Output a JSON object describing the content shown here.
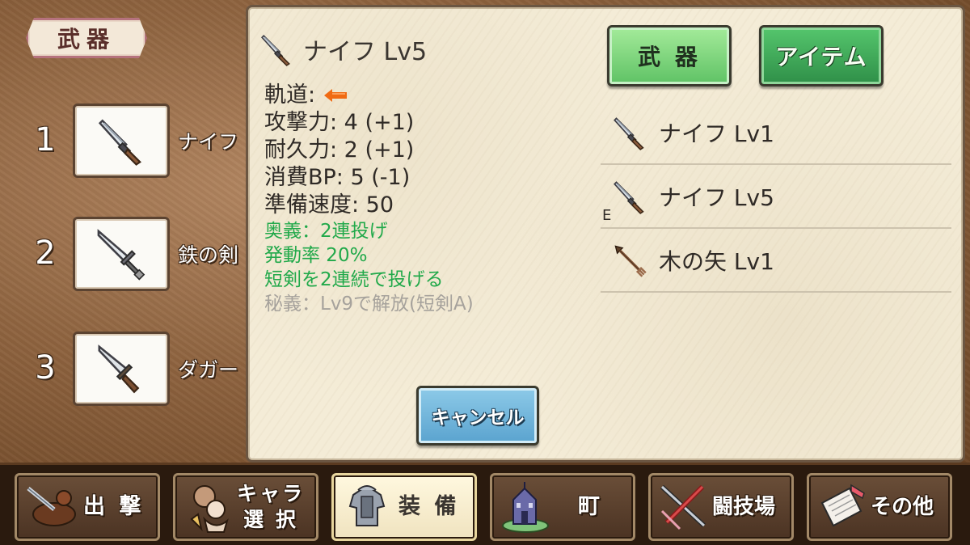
{
  "section_tag": "武器",
  "slots": [
    {
      "number": "1",
      "name": "ナイフ",
      "icon": "knife-icon"
    },
    {
      "number": "2",
      "name": "鉄の剣",
      "icon": "sword-icon"
    },
    {
      "number": "3",
      "name": "ダガー",
      "icon": "dagger-icon"
    }
  ],
  "detail": {
    "title": "ナイフ Lv5",
    "trajectory_label": "軌道:",
    "stats": [
      "攻撃力: 4 (+1)",
      "耐久力: 2 (+1)",
      "消費BP: 5 (-1)",
      "準備速度: 50"
    ],
    "skill_lines": [
      "奥義：2連投げ",
      "発動率 20%",
      "短剣を2連続で投げる"
    ],
    "locked_line": "秘義：Lv9で解放(短剣A)"
  },
  "tabs": {
    "weapon": "武 器",
    "item": "アイテム"
  },
  "inventory": [
    {
      "name": "ナイフ Lv1",
      "icon": "knife-icon",
      "equipped": false
    },
    {
      "name": "ナイフ Lv5",
      "icon": "knife-icon",
      "equipped": true
    },
    {
      "name": "木の矢 Lv1",
      "icon": "arrow-icon",
      "equipped": false
    }
  ],
  "equipped_mark": "E",
  "cancel_label": "キャンセル",
  "nav": [
    {
      "label": "出 撃",
      "icon": "sortie-icon"
    },
    {
      "label_line1": "キャラ",
      "label_line2": "選 択",
      "icon": "character-icon"
    },
    {
      "label": "装 備",
      "icon": "armor-icon",
      "active": true
    },
    {
      "label": "町",
      "icon": "town-icon"
    },
    {
      "label": "闘技場",
      "icon": "arena-icon"
    },
    {
      "label": "その他",
      "icon": "scroll-icon"
    }
  ],
  "colors": {
    "skill_text": "#21a94a",
    "locked_text": "#a6a29c",
    "green_button": "#4fb85f",
    "cancel_button": "#6eb3da",
    "trajectory_arrow": "#f06a12"
  }
}
